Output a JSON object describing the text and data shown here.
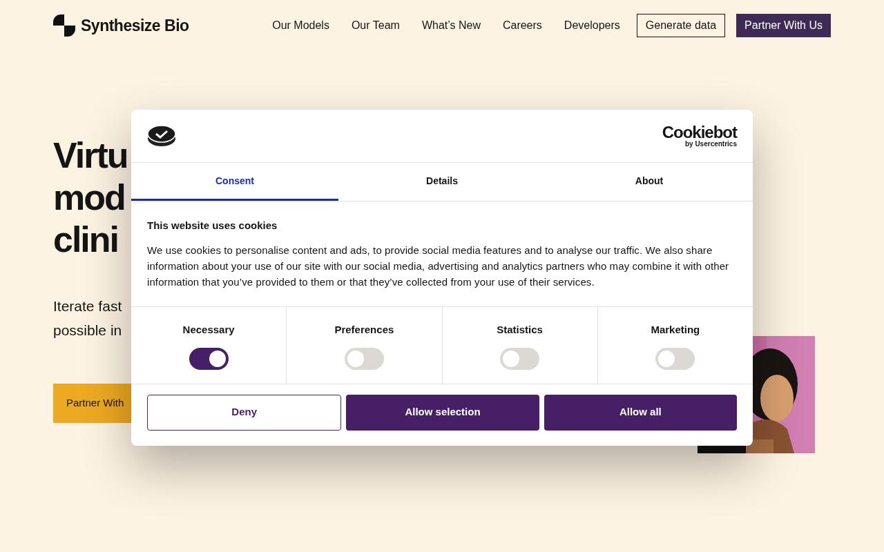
{
  "nav": {
    "brand": "Synthesize Bio",
    "links": [
      "Our Models",
      "Our Team",
      "What’s New",
      "Careers",
      "Developers"
    ],
    "buttons": [
      {
        "label": "Generate data",
        "kind": "outline"
      },
      {
        "label": "Partner With Us",
        "kind": "solid"
      }
    ]
  },
  "hero": {
    "heading_lines": [
      "Virtu",
      "mod",
      "clini"
    ],
    "subtitle_lines": [
      "Iterate fast",
      "possible in"
    ],
    "button": "Partner With"
  },
  "dialog": {
    "brand": "Cookiebot",
    "brand_sub": "by Usercentrics",
    "tabs": [
      {
        "label": "Consent",
        "selected": true
      },
      {
        "label": "Details",
        "selected": false
      },
      {
        "label": "About",
        "selected": false
      }
    ],
    "title": "This website uses cookies",
    "body": "We use cookies to personalise content and ads, to provide social media features and to analyse our traffic. We also share information about your use of our site with our social media, advertising and analytics partners who may combine it with other information that you’ve provided to them or that they’ve collected from your use of their services.",
    "categories": [
      {
        "label": "Necessary",
        "checked": true
      },
      {
        "label": "Preferences",
        "checked": false
      },
      {
        "label": "Statistics",
        "checked": false
      },
      {
        "label": "Marketing",
        "checked": false
      }
    ],
    "buttons": [
      {
        "label": "Deny",
        "kind": "outline"
      },
      {
        "label": "Allow selection",
        "kind": "solid"
      },
      {
        "label": "Allow all",
        "kind": "solid"
      }
    ]
  }
}
